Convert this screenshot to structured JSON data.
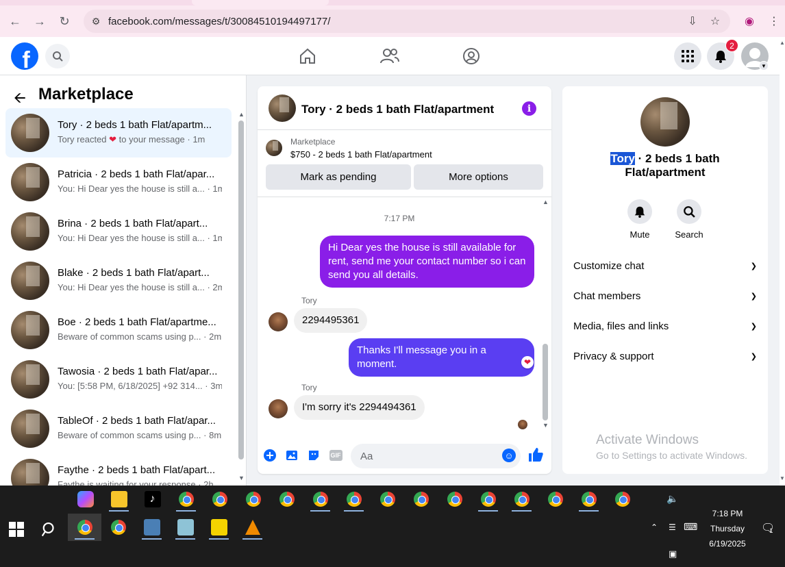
{
  "browser": {
    "url": "facebook.com/messages/t/30084510194497177/"
  },
  "header": {
    "notification_count": "2"
  },
  "left_panel": {
    "title": "Marketplace",
    "conversations": [
      {
        "name": "Tory · 2 beds 1 bath Flat/apartm...",
        "preview_prefix": "Tory reacted",
        "preview_suffix": "to your message · 1m",
        "active": true
      },
      {
        "name": "Patricia · 2 beds 1 bath Flat/apar...",
        "preview": "You: Hi Dear yes the house is still a... · 1m"
      },
      {
        "name": "Brina · 2 beds 1 bath Flat/apart...",
        "preview": "You: Hi Dear yes the house is still a... · 1m"
      },
      {
        "name": "Blake · 2 beds 1 bath Flat/apart...",
        "preview": "You: Hi Dear yes the house is still a... · 2m"
      },
      {
        "name": "Boe · 2 beds 1 bath Flat/apartme...",
        "preview": "Beware of common scams using p... · 2m"
      },
      {
        "name": "Tawosia · 2 beds 1 bath Flat/apar...",
        "preview": "You: [5:58 PM, 6/18/2025] +92 314... · 3m"
      },
      {
        "name": "TableOf · 2 beds 1 bath Flat/apar...",
        "preview": "Beware of common scams using p... · 8m"
      },
      {
        "name": "Faythe · 2 beds 1 bath Flat/apart...",
        "preview": "Faythe is waiting for your response · 2h"
      }
    ]
  },
  "chat": {
    "title": "Tory · 2 beds 1 bath Flat/apartment",
    "marketplace_label": "Marketplace",
    "listing": "$750 - 2 beds 1 bath Flat/apartment",
    "mark_pending_label": "Mark as pending",
    "more_options_label": "More options",
    "timestamp": "7:17 PM",
    "messages": [
      {
        "from": "me",
        "text": "Hi Dear yes the house is still available for rent, send me your contact number so i can send you all details."
      },
      {
        "from": "Tory",
        "sender": "Tory",
        "text": "2294495361"
      },
      {
        "from": "me",
        "text": "Thanks I'll message you in a moment."
      },
      {
        "from": "Tory",
        "sender": "Tory",
        "text": "I'm sorry it's 2294494361"
      }
    ],
    "composer_placeholder": "Aa",
    "gif_label": "GIF"
  },
  "right_panel": {
    "name_highlight": "Tory",
    "name_rest": " · 2 beds 1 bath Flat/apartment",
    "mute_label": "Mute",
    "search_label": "Search",
    "sections": [
      "Customize chat",
      "Chat members",
      "Media, files and links",
      "Privacy & support"
    ]
  },
  "watermark": {
    "line1": "Activate Windows",
    "line2": "Go to Settings to activate Windows."
  },
  "taskbar": {
    "time": "7:18 PM",
    "day": "Thursday",
    "date": "6/19/2025",
    "notif_count": "1"
  },
  "colors": {
    "accent": "#0866ff",
    "purple_bubble": "#8a1ee8",
    "blue_bubble": "#5a3ef2"
  }
}
